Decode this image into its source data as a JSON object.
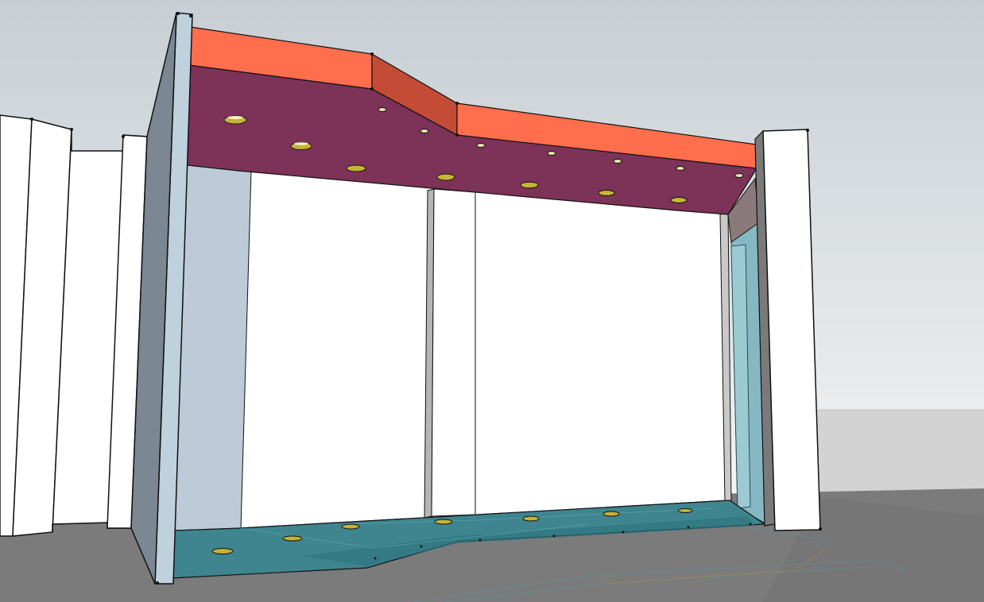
{
  "scene": {
    "sky_top": "#c9d1d6",
    "sky_bottom": "#f2f3f4",
    "ground": "#7b7b7b",
    "bright_ground": "#cfcfcf",
    "ceiling_color": "#7d3258",
    "fascia_color": "#ff6e4d",
    "fascia_dark": "#c44c36",
    "floor_color": "#3f8891",
    "glass_color": "#86b9c4",
    "wall_light": "#bdcdd8",
    "wall_dark": "#7c8590",
    "light_fixture": "#c8b63c"
  }
}
